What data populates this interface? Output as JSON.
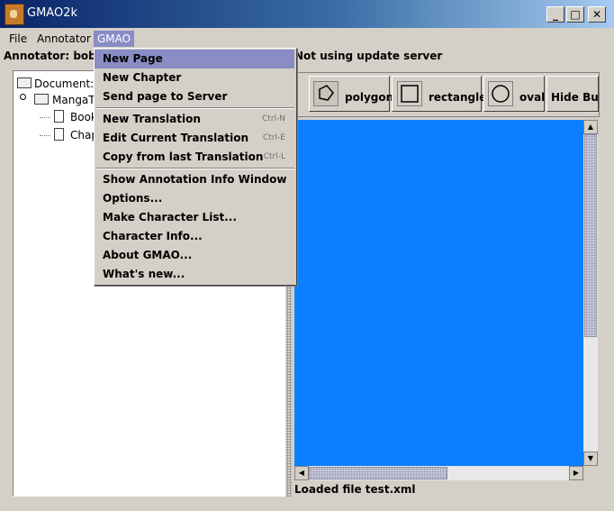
{
  "window": {
    "title": "GMAO2k",
    "minimize": "_",
    "maximize": "□",
    "close": "✕"
  },
  "menubar": {
    "file": "File",
    "annotator": "Annotator",
    "gmao": "GMAO"
  },
  "info": {
    "annotator_label": "Annotator: bobo (",
    "server_status": "Not using update server"
  },
  "tree": {
    "document": "Document:",
    "manga": "MangaTr",
    "book": "Book",
    "chapter": "Chap"
  },
  "toolbar": {
    "polygon": "polygon",
    "rectangle": "rectangle",
    "oval": "oval",
    "hide": "Hide Bubl"
  },
  "status": "Loaded file test.xml",
  "gmao_menu": {
    "new_page": "New Page",
    "new_chapter": "New Chapter",
    "send_page": "Send page to Server",
    "new_translation": "New Translation",
    "new_translation_acc": "Ctrl-N",
    "edit_translation": "Edit Current Translation",
    "edit_translation_acc": "Ctrl-E",
    "copy_translation": "Copy from last Translation",
    "copy_translation_acc": "Ctrl-L",
    "show_info": "Show Annotation Info Window",
    "options": "Options...",
    "make_char_list": "Make Character List...",
    "char_info": "Character Info...",
    "about": "About GMAO...",
    "whats_new": "What's new..."
  },
  "colors": {
    "canvas": "#0b7fff",
    "highlight": "#8a8cc6",
    "title_start": "#0a246a"
  }
}
